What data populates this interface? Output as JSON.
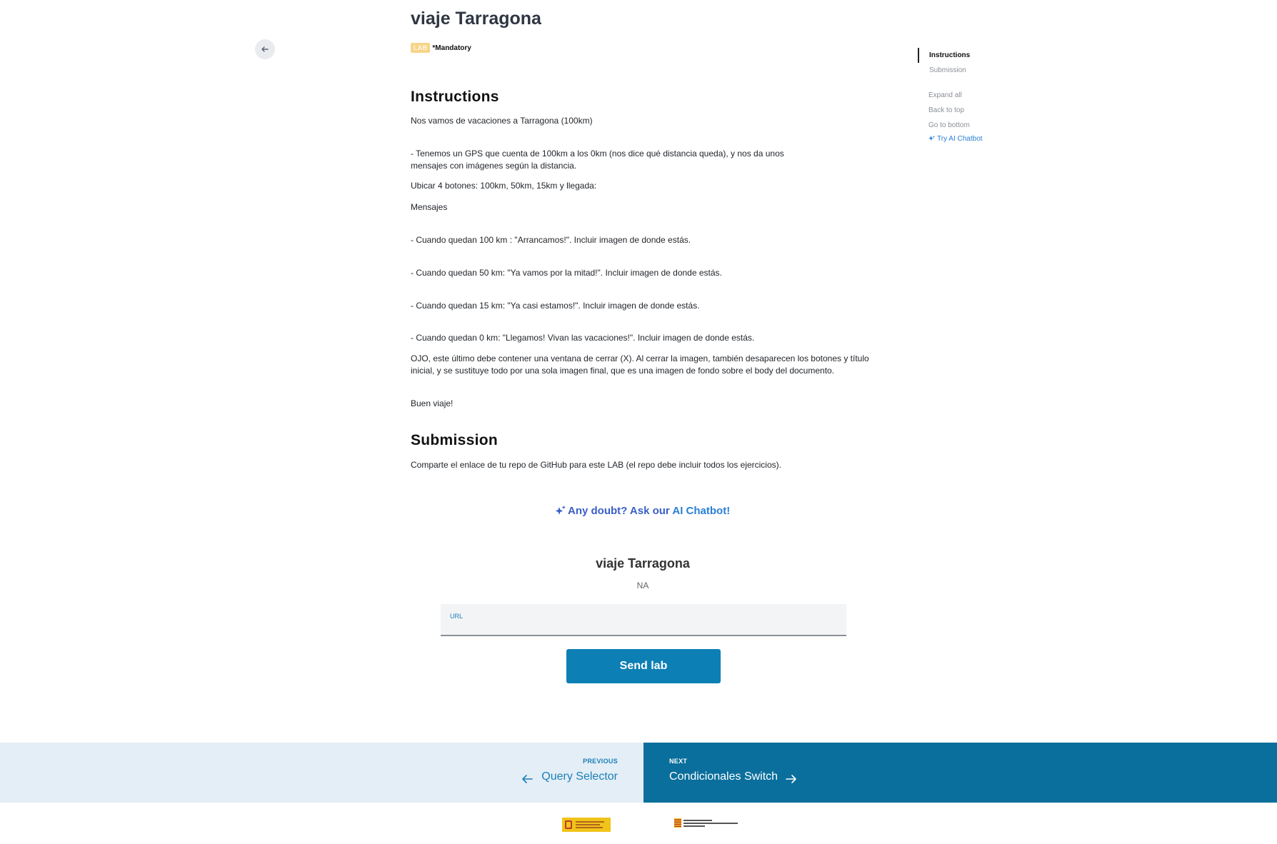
{
  "header": {
    "title": "viaje Tarragona",
    "badge": "LAB",
    "mandatory": "*Mandatory"
  },
  "instructions": {
    "heading": "Instructions",
    "paragraphs": [
      "Nos vamos de vacaciones a Tarragona (100km)",
      "- Tenemos un GPS que cuenta de 100km a los 0km (nos dice qué distancia queda), y nos da unos mensajes con imágenes según la distancia.",
      "Ubicar 4 botones: 100km, 50km, 15km y llegada:",
      "Mensajes",
      "- Cuando quedan 100 km : \"Arrancamos!\". Incluir imagen de donde estás.",
      "- Cuando quedan 50 km: \"Ya vamos por la mitad!\". Incluir imagen de donde estás.",
      "- Cuando quedan 15 km: \"Ya casi estamos!\". Incluir imagen de donde estás.",
      "- Cuando quedan 0 km: \"Llegamos! Vivan las vacaciones!\". Incluir imagen de donde estás.",
      "OJO, este último debe contener una ventana de cerrar (X). Al cerrar la imagen, también desaparecen los botones y título inicial, y se sustituye todo por una sola imagen final, que es una imagen de fondo sobre el body del documento.",
      "Buen viaje!"
    ]
  },
  "submission": {
    "heading": "Submission",
    "text": "Comparte el enlace de tu repo de GitHub para este LAB (el repo debe incluir todos los ejercicios)."
  },
  "toc": {
    "items": [
      "Instructions",
      "Submission"
    ],
    "actions": [
      "Expand all",
      "Back to top",
      "Go to bottom"
    ],
    "chatbot": "Try AI Chatbot"
  },
  "chatbot": {
    "prefix": "Any doubt? Ask our ",
    "highlight": "AI Chatbot!"
  },
  "submit_form": {
    "title": "viaje Tarragona",
    "status": "NA",
    "url_label": "URL",
    "url_value": "",
    "button": "Send lab"
  },
  "navigation": {
    "prev_label": "PREVIOUS",
    "prev_title": "Query Selector",
    "next_label": "NEXT",
    "next_title": "Condicionales Switch"
  },
  "colors": {
    "accent": "#0c7fb5",
    "next_bg": "#0a6f9c",
    "prev_bg": "#e4eef6",
    "badge": "#f7d48b"
  }
}
